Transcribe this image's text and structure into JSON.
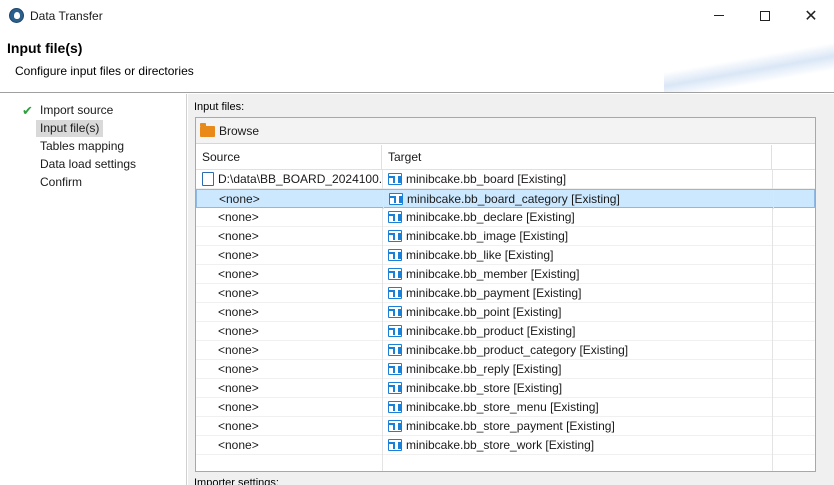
{
  "window": {
    "title": "Data Transfer",
    "controls": {
      "minimize": "minimize",
      "maximize": "maximize",
      "close": "✕"
    }
  },
  "header": {
    "title": "Input file(s)",
    "description": "Configure input files or directories"
  },
  "nav": {
    "items": [
      {
        "label": "Import source",
        "done": true,
        "selected": false
      },
      {
        "label": "Input file(s)",
        "done": false,
        "selected": true
      },
      {
        "label": "Tables mapping",
        "done": false,
        "selected": false
      },
      {
        "label": "Data load settings",
        "done": false,
        "selected": false
      },
      {
        "label": "Confirm",
        "done": false,
        "selected": false
      }
    ]
  },
  "content": {
    "section_label": "Input files:",
    "browse_label": "Browse",
    "columns": {
      "source": "Source",
      "target": "Target"
    },
    "rows": [
      {
        "source": "D:\\data\\BB_BOARD_2024100...",
        "source_icon": "csv-file-icon",
        "target": "minibcake.bb_board [Existing]",
        "selected": false
      },
      {
        "source": "<none>",
        "target": "minibcake.bb_board_category [Existing]",
        "selected": true
      },
      {
        "source": "<none>",
        "target": "minibcake.bb_declare [Existing]",
        "selected": false
      },
      {
        "source": "<none>",
        "target": "minibcake.bb_image [Existing]",
        "selected": false
      },
      {
        "source": "<none>",
        "target": "minibcake.bb_like [Existing]",
        "selected": false
      },
      {
        "source": "<none>",
        "target": "minibcake.bb_member [Existing]",
        "selected": false
      },
      {
        "source": "<none>",
        "target": "minibcake.bb_payment [Existing]",
        "selected": false
      },
      {
        "source": "<none>",
        "target": "minibcake.bb_point [Existing]",
        "selected": false
      },
      {
        "source": "<none>",
        "target": "minibcake.bb_product [Existing]",
        "selected": false
      },
      {
        "source": "<none>",
        "target": "minibcake.bb_product_category [Existing]",
        "selected": false
      },
      {
        "source": "<none>",
        "target": "minibcake.bb_reply [Existing]",
        "selected": false
      },
      {
        "source": "<none>",
        "target": "minibcake.bb_store [Existing]",
        "selected": false
      },
      {
        "source": "<none>",
        "target": "minibcake.bb_store_menu [Existing]",
        "selected": false
      },
      {
        "source": "<none>",
        "target": "minibcake.bb_store_payment [Existing]",
        "selected": false
      },
      {
        "source": "<none>",
        "target": "minibcake.bb_store_work [Existing]",
        "selected": false
      }
    ],
    "importer_label": "Importer settings:"
  },
  "colors": {
    "selection": "#cce8ff",
    "check": "#2e9e3e",
    "table_icon": "#1a7fd6",
    "folder_icon": "#e8891a"
  }
}
